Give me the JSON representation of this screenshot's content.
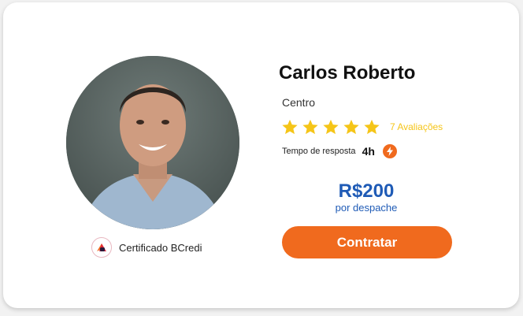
{
  "profile": {
    "name": "Carlos Roberto",
    "location": "Centro",
    "rating": 5,
    "reviews_label": "7 Avaliações",
    "response_label": "Tempo de resposta",
    "response_value": "4h"
  },
  "certification": {
    "label": "Certificado BCredi",
    "icon": "bcredi-logo"
  },
  "pricing": {
    "price": "R$200",
    "unit": "por despache"
  },
  "actions": {
    "hire_label": "Contratar"
  },
  "colors": {
    "accent": "#f06a1e",
    "star": "#f5c518",
    "price": "#1f5bb6"
  }
}
